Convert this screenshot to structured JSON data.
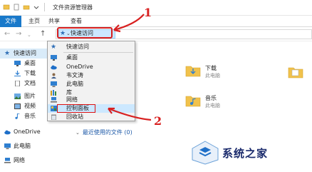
{
  "window": {
    "title": "文件资源管理器"
  },
  "ribbon": {
    "tabs": [
      "文件",
      "主页",
      "共享",
      "查看"
    ]
  },
  "address": {
    "current_location": "快速访问",
    "back_icon": "arrow-left-icon",
    "forward_icon": "arrow-right-icon",
    "recent_icon": "chevron-down-icon",
    "up_icon": "arrow-up-icon"
  },
  "sidebar": {
    "items": [
      {
        "label": "快速访问",
        "icon": "star-icon"
      },
      {
        "label": "桌面",
        "icon": "desktop-icon"
      },
      {
        "label": "下载",
        "icon": "download-icon"
      },
      {
        "label": "文档",
        "icon": "document-icon"
      },
      {
        "label": "图片",
        "icon": "picture-icon"
      },
      {
        "label": "视频",
        "icon": "video-icon"
      },
      {
        "label": "音乐",
        "icon": "music-icon"
      },
      {
        "label": "OneDrive",
        "icon": "cloud-icon"
      },
      {
        "label": "此电脑",
        "icon": "computer-icon"
      },
      {
        "label": "网络",
        "icon": "network-icon"
      }
    ]
  },
  "dropdown": {
    "items": [
      {
        "label": "快速访问",
        "icon": "star-icon"
      },
      {
        "label": "桌面",
        "icon": "desktop-icon"
      },
      {
        "label": "OneDrive",
        "icon": "cloud-icon"
      },
      {
        "label": "韦文涛",
        "icon": "user-icon"
      },
      {
        "label": "此电脑",
        "icon": "computer-icon"
      },
      {
        "label": "库",
        "icon": "library-icon"
      },
      {
        "label": "网络",
        "icon": "network-icon"
      },
      {
        "label": "控制面板",
        "icon": "control-panel-icon"
      },
      {
        "label": "回收站",
        "icon": "recycle-bin-icon"
      }
    ]
  },
  "content": {
    "folders": [
      {
        "name": "下载",
        "location": "此电脑"
      },
      {
        "name": "音乐",
        "location": "此电脑"
      }
    ],
    "recent_files_header": "最近使用的文件 (0)"
  },
  "annotations": {
    "step1": "1",
    "step2": "2"
  },
  "watermark": {
    "text": "系统之家"
  },
  "colors": {
    "accent": "#1979ca",
    "highlight": "#cce8ff",
    "annotation_red": "#d82020",
    "folder_yellow": "#f1c24c"
  }
}
